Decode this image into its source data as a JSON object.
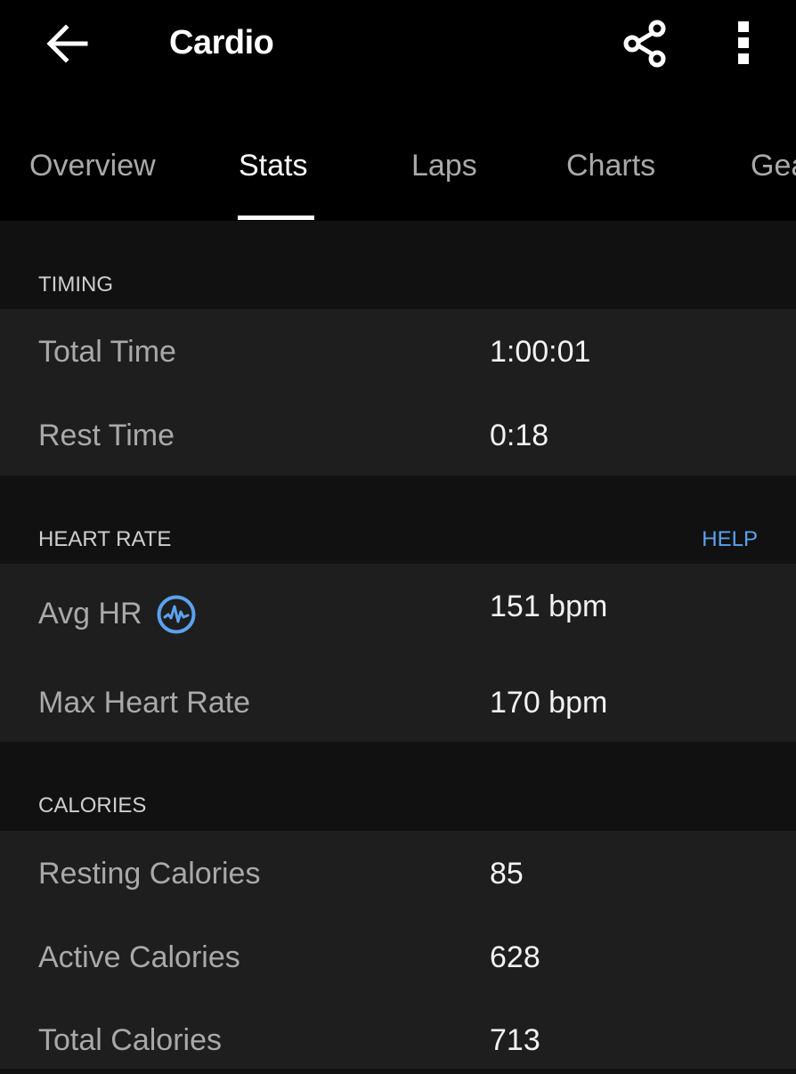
{
  "appbar": {
    "title": "Cardio",
    "back_icon": "arrow-left-icon",
    "share_icon": "share-icon",
    "more_icon": "more-vertical-icon"
  },
  "tabs": [
    {
      "label": "Overview",
      "active": false
    },
    {
      "label": "Stats",
      "active": true
    },
    {
      "label": "Laps",
      "active": false
    },
    {
      "label": "Charts",
      "active": false
    },
    {
      "label": "Gear",
      "active": false
    }
  ],
  "sections": {
    "timing": {
      "title": "TIMING",
      "rows": [
        {
          "label": "Total Time",
          "value": "1:00:01"
        },
        {
          "label": "Rest Time",
          "value": "0:18"
        }
      ]
    },
    "heart_rate": {
      "title": "HEART RATE",
      "help_label": "HELP",
      "rows": [
        {
          "label": "Avg HR",
          "value": "151 bpm",
          "icon": "heart-rate-pulse-icon"
        },
        {
          "label": "Max Heart Rate",
          "value": "170 bpm"
        }
      ]
    },
    "calories": {
      "title": "CALORIES",
      "rows": [
        {
          "label": "Resting Calories",
          "value": "85"
        },
        {
          "label": "Active Calories",
          "value": "628"
        },
        {
          "label": "Total Calories",
          "value": "713"
        }
      ]
    }
  },
  "colors": {
    "accent": "#5aa2ee",
    "appbar_bg": "#000000",
    "section_bg": "#111111",
    "card_bg": "#1e1e1e"
  }
}
